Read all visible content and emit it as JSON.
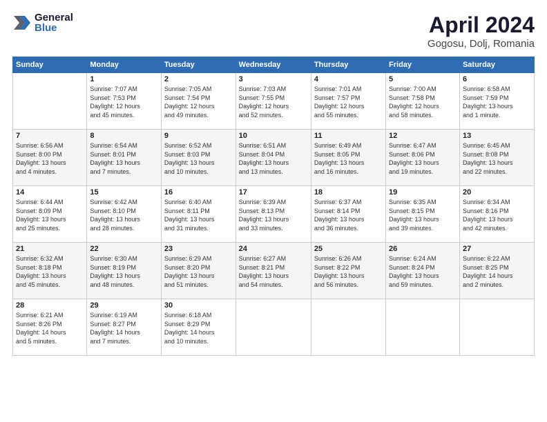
{
  "header": {
    "logo_general": "General",
    "logo_blue": "Blue",
    "title": "April 2024",
    "location": "Gogosu, Dolj, Romania"
  },
  "days_of_week": [
    "Sunday",
    "Monday",
    "Tuesday",
    "Wednesday",
    "Thursday",
    "Friday",
    "Saturday"
  ],
  "weeks": [
    [
      {
        "day": "",
        "info": ""
      },
      {
        "day": "1",
        "info": "Sunrise: 7:07 AM\nSunset: 7:53 PM\nDaylight: 12 hours\nand 45 minutes."
      },
      {
        "day": "2",
        "info": "Sunrise: 7:05 AM\nSunset: 7:54 PM\nDaylight: 12 hours\nand 49 minutes."
      },
      {
        "day": "3",
        "info": "Sunrise: 7:03 AM\nSunset: 7:55 PM\nDaylight: 12 hours\nand 52 minutes."
      },
      {
        "day": "4",
        "info": "Sunrise: 7:01 AM\nSunset: 7:57 PM\nDaylight: 12 hours\nand 55 minutes."
      },
      {
        "day": "5",
        "info": "Sunrise: 7:00 AM\nSunset: 7:58 PM\nDaylight: 12 hours\nand 58 minutes."
      },
      {
        "day": "6",
        "info": "Sunrise: 6:58 AM\nSunset: 7:59 PM\nDaylight: 13 hours\nand 1 minute."
      }
    ],
    [
      {
        "day": "7",
        "info": "Sunrise: 6:56 AM\nSunset: 8:00 PM\nDaylight: 13 hours\nand 4 minutes."
      },
      {
        "day": "8",
        "info": "Sunrise: 6:54 AM\nSunset: 8:01 PM\nDaylight: 13 hours\nand 7 minutes."
      },
      {
        "day": "9",
        "info": "Sunrise: 6:52 AM\nSunset: 8:03 PM\nDaylight: 13 hours\nand 10 minutes."
      },
      {
        "day": "10",
        "info": "Sunrise: 6:51 AM\nSunset: 8:04 PM\nDaylight: 13 hours\nand 13 minutes."
      },
      {
        "day": "11",
        "info": "Sunrise: 6:49 AM\nSunset: 8:05 PM\nDaylight: 13 hours\nand 16 minutes."
      },
      {
        "day": "12",
        "info": "Sunrise: 6:47 AM\nSunset: 8:06 PM\nDaylight: 13 hours\nand 19 minutes."
      },
      {
        "day": "13",
        "info": "Sunrise: 6:45 AM\nSunset: 8:08 PM\nDaylight: 13 hours\nand 22 minutes."
      }
    ],
    [
      {
        "day": "14",
        "info": "Sunrise: 6:44 AM\nSunset: 8:09 PM\nDaylight: 13 hours\nand 25 minutes."
      },
      {
        "day": "15",
        "info": "Sunrise: 6:42 AM\nSunset: 8:10 PM\nDaylight: 13 hours\nand 28 minutes."
      },
      {
        "day": "16",
        "info": "Sunrise: 6:40 AM\nSunset: 8:11 PM\nDaylight: 13 hours\nand 31 minutes."
      },
      {
        "day": "17",
        "info": "Sunrise: 6:39 AM\nSunset: 8:13 PM\nDaylight: 13 hours\nand 33 minutes."
      },
      {
        "day": "18",
        "info": "Sunrise: 6:37 AM\nSunset: 8:14 PM\nDaylight: 13 hours\nand 36 minutes."
      },
      {
        "day": "19",
        "info": "Sunrise: 6:35 AM\nSunset: 8:15 PM\nDaylight: 13 hours\nand 39 minutes."
      },
      {
        "day": "20",
        "info": "Sunrise: 6:34 AM\nSunset: 8:16 PM\nDaylight: 13 hours\nand 42 minutes."
      }
    ],
    [
      {
        "day": "21",
        "info": "Sunrise: 6:32 AM\nSunset: 8:18 PM\nDaylight: 13 hours\nand 45 minutes."
      },
      {
        "day": "22",
        "info": "Sunrise: 6:30 AM\nSunset: 8:19 PM\nDaylight: 13 hours\nand 48 minutes."
      },
      {
        "day": "23",
        "info": "Sunrise: 6:29 AM\nSunset: 8:20 PM\nDaylight: 13 hours\nand 51 minutes."
      },
      {
        "day": "24",
        "info": "Sunrise: 6:27 AM\nSunset: 8:21 PM\nDaylight: 13 hours\nand 54 minutes."
      },
      {
        "day": "25",
        "info": "Sunrise: 6:26 AM\nSunset: 8:22 PM\nDaylight: 13 hours\nand 56 minutes."
      },
      {
        "day": "26",
        "info": "Sunrise: 6:24 AM\nSunset: 8:24 PM\nDaylight: 13 hours\nand 59 minutes."
      },
      {
        "day": "27",
        "info": "Sunrise: 6:22 AM\nSunset: 8:25 PM\nDaylight: 14 hours\nand 2 minutes."
      }
    ],
    [
      {
        "day": "28",
        "info": "Sunrise: 6:21 AM\nSunset: 8:26 PM\nDaylight: 14 hours\nand 5 minutes."
      },
      {
        "day": "29",
        "info": "Sunrise: 6:19 AM\nSunset: 8:27 PM\nDaylight: 14 hours\nand 7 minutes."
      },
      {
        "day": "30",
        "info": "Sunrise: 6:18 AM\nSunset: 8:29 PM\nDaylight: 14 hours\nand 10 minutes."
      },
      {
        "day": "",
        "info": ""
      },
      {
        "day": "",
        "info": ""
      },
      {
        "day": "",
        "info": ""
      },
      {
        "day": "",
        "info": ""
      }
    ]
  ]
}
